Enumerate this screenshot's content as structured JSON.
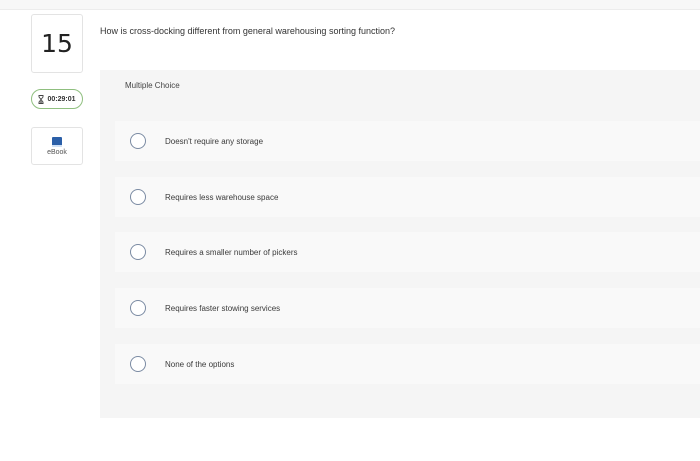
{
  "question": {
    "number": "15",
    "text": "How is cross-docking different from general warehousing sorting function?"
  },
  "timer": {
    "value": "00:29:01",
    "icon": "hourglass-icon"
  },
  "ebook": {
    "label": "eBook",
    "icon": "book-icon"
  },
  "answer_panel": {
    "title": "Multiple Choice",
    "options": [
      {
        "label": "Doesn't require any storage",
        "selected": false
      },
      {
        "label": "Requires less warehouse space",
        "selected": false
      },
      {
        "label": "Requires a smaller number of pickers",
        "selected": false
      },
      {
        "label": "Requires faster stowing services",
        "selected": false
      },
      {
        "label": "None of the options",
        "selected": false
      }
    ]
  },
  "colors": {
    "timer_border": "#8fbf7f",
    "radio_border": "#7b8ba3",
    "book": "#2b5fa8",
    "panel_bg": "#f5f5f5"
  }
}
